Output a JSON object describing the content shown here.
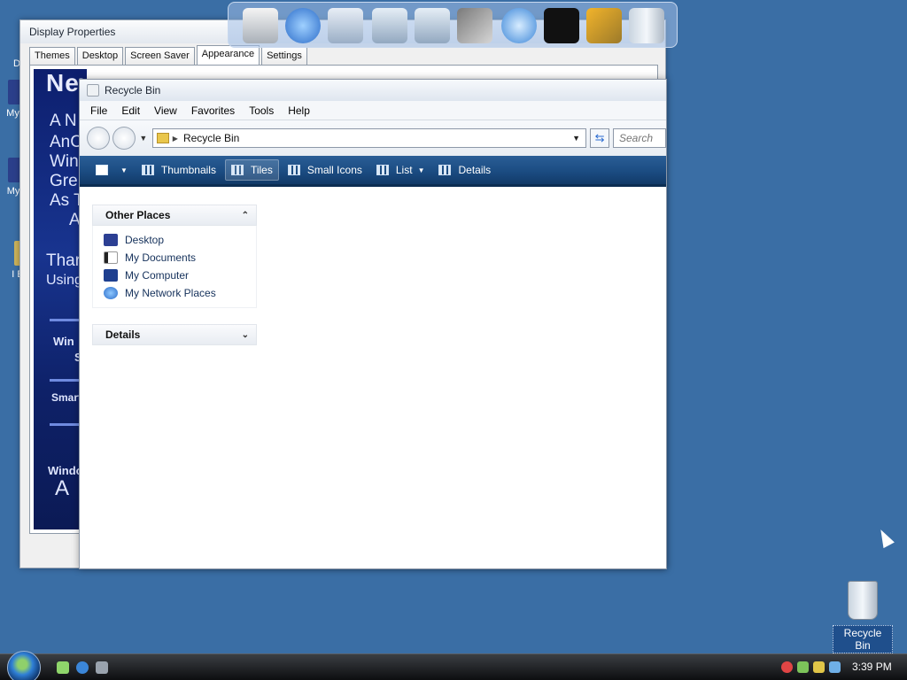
{
  "display_properties": {
    "title": "Display Properties",
    "tabs": [
      "Themes",
      "Desktop",
      "Screen Saver",
      "Appearance",
      "Settings"
    ],
    "active_tab": "Appearance",
    "preview_text": {
      "headline": "New World",
      "lines": [
        "A N",
        "AnC",
        "Win",
        "Gre",
        "As T",
        "A",
        "Thar",
        "Using",
        "Win",
        "S",
        "Smart",
        "Windo",
        "A"
      ]
    }
  },
  "dock": {
    "icons": [
      "computer-icon",
      "globe-icon",
      "folder-icon",
      "folder-music-icon",
      "folder-pictures-icon",
      "tools-icon",
      "ie-icon",
      "tshirt-icon",
      "wrench-icon",
      "recycle-bin-icon"
    ]
  },
  "recycle_bin_window": {
    "title": "Recycle Bin",
    "menu": [
      "File",
      "Edit",
      "View",
      "Favorites",
      "Tools",
      "Help"
    ],
    "address": "Recycle Bin",
    "search_placeholder": "Search",
    "views": [
      {
        "label": "Thumbnails",
        "active": false
      },
      {
        "label": "Tiles",
        "active": true
      },
      {
        "label": "Small Icons",
        "active": false
      },
      {
        "label": "List",
        "active": false
      },
      {
        "label": "Details",
        "active": false
      }
    ],
    "other_places": {
      "heading": "Other Places",
      "items": [
        "Desktop",
        "My Documents",
        "My Computer",
        "My Network Places"
      ]
    },
    "details": {
      "heading": "Details"
    }
  },
  "desktop": {
    "left_icon_labels": [
      "Do",
      "My C",
      "My F",
      "I E"
    ],
    "recycle_bin_label": "Recycle Bin"
  },
  "taskbar": {
    "clock": "3:39 PM"
  },
  "colors": {
    "desktop": "#3a6ea5",
    "viewbar": "#1b4c82",
    "accent": "#2a6bd1"
  }
}
